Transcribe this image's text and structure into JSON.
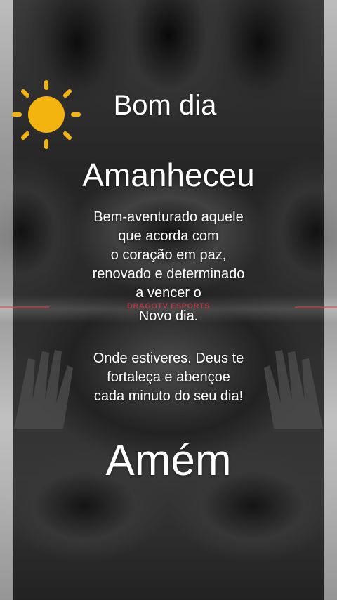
{
  "post": {
    "greeting": "Bom dia",
    "title": "Amanheceu",
    "body_lines": [
      "Bem-aventurado aquele",
      "que acorda com",
      "o coração em paz,",
      "renovado e determinado",
      "a vencer o",
      "Novo dia.",
      "Onde estiveres. Deus te",
      "fortaleça e abençoe",
      "cada minuto do seu dia!"
    ],
    "closing": "Amém"
  },
  "watermark": {
    "text": "DRAGOTV ESPORTS"
  },
  "icons": {
    "sun": "sun-icon"
  },
  "colors": {
    "sun": "#f4b40f",
    "text": "#ffffff",
    "watermark": "#d23c46"
  }
}
